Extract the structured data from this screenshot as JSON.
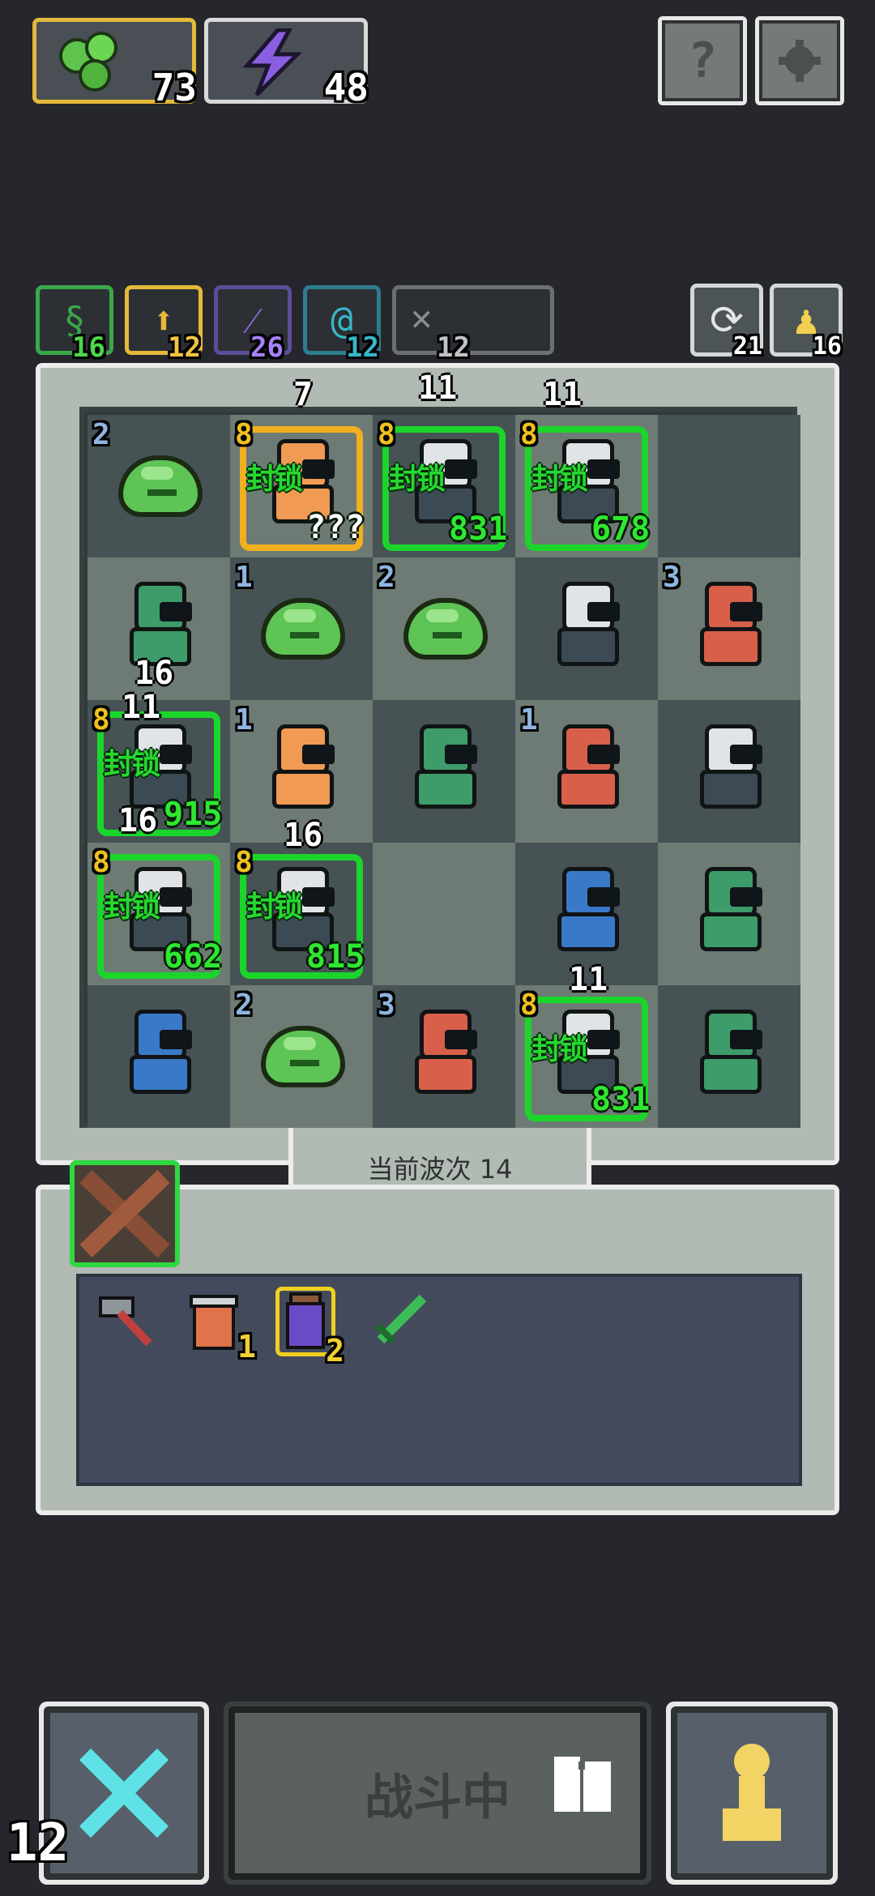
{
  "resources": {
    "slime": {
      "icon": "green-slime-orb-icon",
      "value": "73"
    },
    "energy": {
      "icon": "purple-lightning-icon",
      "value": "48"
    }
  },
  "top_buttons": {
    "help_icon": "question-icon",
    "help_label": "?",
    "settings_icon": "gear-icon"
  },
  "category_tabs": [
    {
      "icon": "green-rune-icon",
      "value": "16",
      "color": "#3aa84a"
    },
    {
      "icon": "gold-arrow-up-icon",
      "value": "12",
      "color": "#e5b93a"
    },
    {
      "icon": "purple-slash-icon",
      "value": "26",
      "color": "#8a6ad8"
    },
    {
      "icon": "cyan-swirl-icon",
      "value": "12",
      "color": "#38b6c8"
    },
    {
      "icon": "gray-crossed-swords-icon",
      "value": "12",
      "color": "#8a8e90"
    }
  ],
  "side_counters": [
    {
      "icon": "refresh-icon",
      "value": "21"
    },
    {
      "icon": "yellow-pawn-icon",
      "value": "16"
    }
  ],
  "board_numbers": {
    "r1c2_over": "7",
    "r1c3_over": "11",
    "r1c4_over": "11",
    "r3c1_over": "16",
    "r3c1_over2": "11",
    "r4c1_over": "16",
    "r4c2_over": "16",
    "r5c4_over": "11"
  },
  "cells": {
    "r1c1_lvl": "2",
    "r1c2_lvl": "8",
    "r1c2_lock": "封锁",
    "r1c2_hp": "???",
    "r1c3_lvl": "8",
    "r1c3_lock": "封锁",
    "r1c3_hp": "831",
    "r1c4_lvl": "8",
    "r1c4_lock": "封锁",
    "r1c4_hp": "678",
    "r2c2_lvl": "1",
    "r2c3_lvl": "2",
    "r2c5_lvl": "3",
    "r3c1_lvl": "8",
    "r3c1_lock": "封锁",
    "r3c1_hp": "915",
    "r3c2_lvl": "1",
    "r3c4_lvl": "1",
    "r4c1_lvl": "8",
    "r4c1_lock": "封锁",
    "r4c1_hp": "662",
    "r4c2_lvl": "8",
    "r4c2_lock": "封锁",
    "r4c2_hp": "815",
    "r5c2_lvl": "2",
    "r5c3_lvl": "3",
    "r5c4_lvl": "8",
    "r5c4_lock": "封锁",
    "r5c4_hp": "831"
  },
  "wave": {
    "label": "当前波次 14"
  },
  "inventory": {
    "header_icon": "crossed-swords-icon",
    "items": [
      {
        "icon": "hammer-icon",
        "count": ""
      },
      {
        "icon": "trash-can-icon",
        "count": "1"
      },
      {
        "icon": "potion-jar-icon",
        "count": "2"
      },
      {
        "icon": "green-sword-icon",
        "count": ""
      }
    ]
  },
  "bottom": {
    "battle_label": "战斗中",
    "left_icon": "cyan-crossed-swords-icon",
    "right_icon": "yellow-pawn-icon",
    "speed_icon": "flag-icon",
    "corner_counter": "12"
  }
}
